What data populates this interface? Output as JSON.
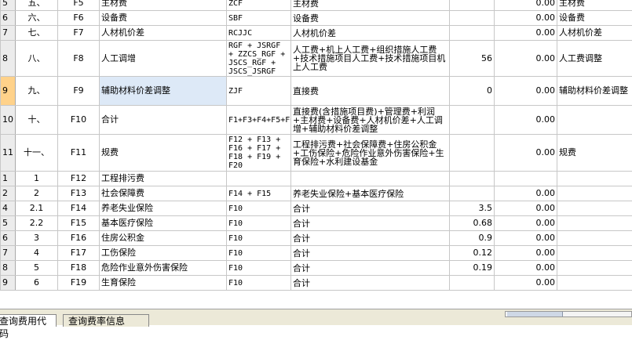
{
  "rows": [
    {
      "rn": "5",
      "seq": "五、",
      "code": "F5",
      "name": "主材费",
      "base": "ZCF",
      "desc": "主材费",
      "rate": "",
      "amount": "0.00",
      "remark": "主材费"
    },
    {
      "rn": "6",
      "seq": "六、",
      "code": "F6",
      "name": "设备费",
      "base": "SBF",
      "desc": "设备费",
      "rate": "",
      "amount": "0.00",
      "remark": "设备费"
    },
    {
      "rn": "7",
      "seq": "七、",
      "code": "F7",
      "name": "人材机价差",
      "base": "RCJJC",
      "desc": "人材机价差",
      "rate": "",
      "amount": "0.00",
      "remark": "人材机价差"
    },
    {
      "rn": "8",
      "seq": "八、",
      "code": "F8",
      "name": "人工调增",
      "base": "RGF + JSRGF + ZZCS_RGF + JSCS_RGF + JSCS_JSRGF",
      "desc": "人工费+机上人工费+组织措施人工费+技术措施项目人工费+技术措施项目机上人工费",
      "rate": "56",
      "amount": "0.00",
      "remark": "人工费调整"
    },
    {
      "rn": "9",
      "seq": "九、",
      "code": "F9",
      "name": "辅助材料价差调整",
      "base": "ZJF",
      "desc": "直接费",
      "rate": "0",
      "amount": "0.00",
      "remark": "辅助材料价差调整"
    },
    {
      "rn": "10",
      "seq": "十、",
      "code": "F10",
      "name": "合计",
      "base": "F1+F3+F4+F5+F6+F7+F8+F9",
      "desc": "直接费(含措施项目费)+管理费+利润+主材费+设备费+人材机价差+人工调增+辅助材料价差调整",
      "rate": "",
      "amount": "0.00",
      "remark": ""
    },
    {
      "rn": "11",
      "seq": "十一、",
      "code": "F11",
      "name": "规费",
      "base": "F12 + F13 + F16 + F17 + F18 + F19 + F20",
      "desc": "工程排污费+社会保障费+住房公积金+工伤保险+危险作业意外伤害保险+生育保险+水利建设基金",
      "rate": "",
      "amount": "0.00",
      "remark": "规费"
    },
    {
      "rn": "1",
      "seq": "1",
      "code": "F12",
      "name": "工程排污费",
      "base": "",
      "desc": "",
      "rate": "",
      "amount": "",
      "remark": ""
    },
    {
      "rn": "2",
      "seq": "2",
      "code": "F13",
      "name": "社会保障费",
      "base": "F14 + F15",
      "desc": "养老失业保险+基本医疗保险",
      "rate": "",
      "amount": "0.00",
      "remark": ""
    },
    {
      "rn": "4",
      "seq": "2.1",
      "code": "F14",
      "name": "养老失业保险",
      "base": "F10",
      "desc": "合计",
      "rate": "3.5",
      "amount": "0.00",
      "remark": ""
    },
    {
      "rn": "5",
      "seq": "2.2",
      "code": "F15",
      "name": "基本医疗保险",
      "base": "F10",
      "desc": "合计",
      "rate": "0.68",
      "amount": "0.00",
      "remark": ""
    },
    {
      "rn": "6",
      "seq": "3",
      "code": "F16",
      "name": "住房公积金",
      "base": "F10",
      "desc": "合计",
      "rate": "0.9",
      "amount": "0.00",
      "remark": ""
    },
    {
      "rn": "7",
      "seq": "4",
      "code": "F17",
      "name": "工伤保险",
      "base": "F10",
      "desc": "合计",
      "rate": "0.12",
      "amount": "0.00",
      "remark": ""
    },
    {
      "rn": "8",
      "seq": "5",
      "code": "F18",
      "name": "危险作业意外伤害保险",
      "base": "F10",
      "desc": "合计",
      "rate": "0.19",
      "amount": "0.00",
      "remark": ""
    },
    {
      "rn": "9",
      "seq": "6",
      "code": "F19",
      "name": "生育保险",
      "base": "F10",
      "desc": "合计",
      "rate": "",
      "amount": "0.00",
      "remark": ""
    }
  ],
  "tabs": {
    "tab1": "查询费用代码",
    "tab2": "查询费率信息"
  }
}
